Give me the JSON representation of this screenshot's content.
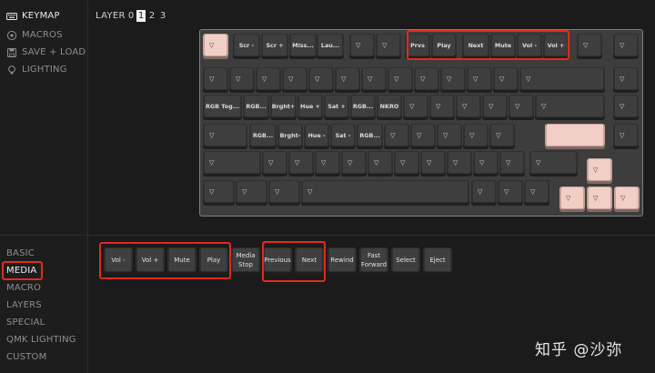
{
  "sidebar": {
    "nav": [
      {
        "label": "KEYMAP",
        "icon": "keyboard-icon",
        "active": true
      },
      {
        "label": "MACROS",
        "icon": "circle-play-icon",
        "active": false
      },
      {
        "label": "SAVE + LOAD",
        "icon": "save-icon",
        "active": false
      },
      {
        "label": "LIGHTING",
        "icon": "bulb-icon",
        "active": false
      }
    ],
    "categories": [
      {
        "label": "BASIC",
        "active": false
      },
      {
        "label": "MEDIA",
        "active": true
      },
      {
        "label": "MACRO",
        "active": false
      },
      {
        "label": "LAYERS",
        "active": false
      },
      {
        "label": "SPECIAL",
        "active": false
      },
      {
        "label": "QMK LIGHTING",
        "active": false
      },
      {
        "label": "CUSTOM",
        "active": false
      }
    ]
  },
  "layers": {
    "label": "LAYER",
    "items": [
      "0",
      "1",
      "2",
      "3"
    ],
    "active_index": 1
  },
  "keyboard": {
    "row0": [
      "▽",
      "Scr -",
      "Scr +",
      "Miss...",
      "Lau...",
      "▽",
      "▽",
      "Prvs",
      "Play",
      "Next",
      "Mute",
      "Vol -",
      "Vol +",
      "▽",
      "▽"
    ],
    "row1": [
      "▽",
      "▽",
      "▽",
      "▽",
      "▽",
      "▽",
      "▽",
      "▽",
      "▽",
      "▽",
      "▽",
      "▽",
      "▽",
      "▽"
    ],
    "row2": [
      "RGB Tog...",
      "RGB...",
      "Brght+",
      "Hue +",
      "Sat +",
      "RGB...",
      "NKRO",
      "▽",
      "▽",
      "▽",
      "▽",
      "▽",
      "▽",
      "▽"
    ],
    "row3": [
      "▽",
      "RGB...",
      "Brght-",
      "Hue -",
      "Sat -",
      "RGB...",
      "▽",
      "▽",
      "▽",
      "▽",
      "▽",
      "",
      "▽"
    ],
    "row4": [
      "▽",
      "▽",
      "▽",
      "▽",
      "▽",
      "▽",
      "▽",
      "▽",
      "▽",
      "▽",
      "▽",
      "▽",
      "▽"
    ],
    "row5": [
      "▽",
      "▽",
      "▽",
      "▽",
      "▽",
      "▽",
      "▽",
      "▽",
      "▽",
      "▽"
    ]
  },
  "media_keys": [
    {
      "label": "Vol -"
    },
    {
      "label": "Vol +"
    },
    {
      "label": "Mute"
    },
    {
      "label": "Play"
    },
    {
      "label": "Media\nStop"
    },
    {
      "label": "Previous"
    },
    {
      "label": "Next"
    },
    {
      "label": "Rewind"
    },
    {
      "label": "Fast\nForward"
    },
    {
      "label": "Select"
    },
    {
      "label": "Eject"
    }
  ],
  "watermark": "知乎 @沙弥",
  "colors": {
    "background": "#1b1b1b",
    "keycap": "#3e3e3e",
    "highlight_key": "#f1cfc5",
    "annotation_red": "#e02b1e"
  }
}
